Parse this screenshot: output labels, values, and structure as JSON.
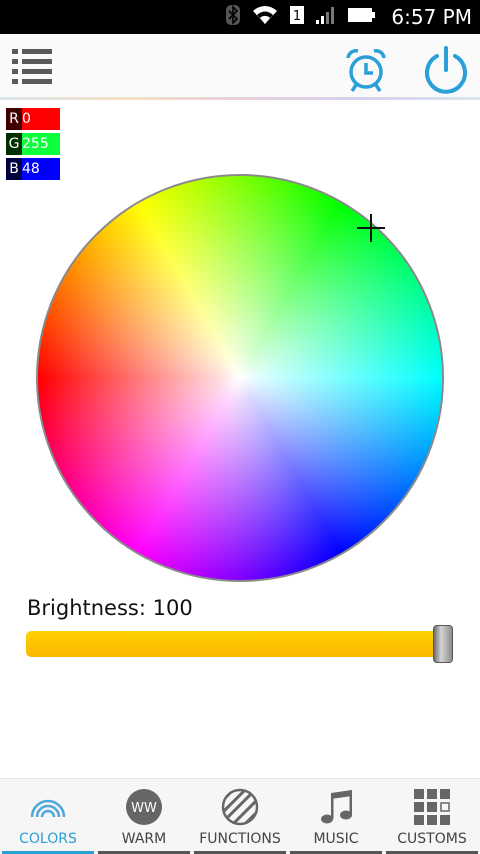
{
  "status_bar": {
    "time": "6:57 PM",
    "icons": [
      "bluetooth-icon",
      "wifi-icon",
      "sim-icon",
      "signal-icon",
      "battery-icon"
    ]
  },
  "toolbar": {
    "icons": [
      "menu-icon",
      "alarm-clock-icon",
      "power-icon"
    ],
    "accent_color": "#2a9fd8"
  },
  "rgb": {
    "r_label": "R",
    "r_value": "0",
    "g_label": "G",
    "g_value": "255",
    "b_label": "B",
    "b_value": "48"
  },
  "brightness": {
    "label": "Brightness: 100",
    "value": 100,
    "max": 100,
    "track_color": "#ffc800"
  },
  "bottom_nav": {
    "tabs": [
      {
        "label": "COLORS",
        "icon": "rainbow-icon",
        "active": true
      },
      {
        "label": "WARM",
        "icon": "ww-icon",
        "active": false
      },
      {
        "label": "FUNCTIONS",
        "icon": "stripes-icon",
        "active": false
      },
      {
        "label": "MUSIC",
        "icon": "music-note-icon",
        "active": false
      },
      {
        "label": "CUSTOMS",
        "icon": "grid-icon",
        "active": false
      }
    ],
    "ww_text": "WW"
  }
}
